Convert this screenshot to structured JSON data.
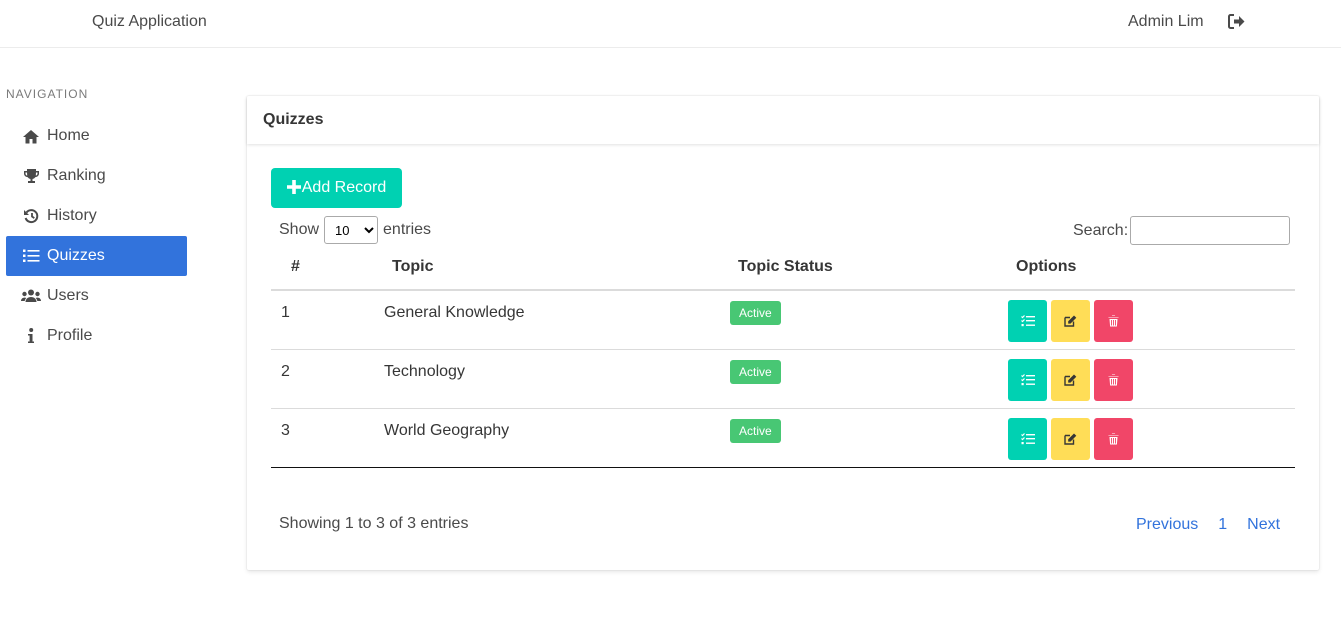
{
  "navbar": {
    "brand": "Quiz Application",
    "user": "Admin Lim",
    "logout_icon": "sign-out-icon"
  },
  "sidebar": {
    "label": "NAVIGATION",
    "items": [
      {
        "label": "Home",
        "icon": "home-icon"
      },
      {
        "label": "Ranking",
        "icon": "trophy-icon"
      },
      {
        "label": "History",
        "icon": "history-icon"
      },
      {
        "label": "Quizzes",
        "icon": "list-icon",
        "active": true
      },
      {
        "label": "Users",
        "icon": "users-icon"
      },
      {
        "label": "Profile",
        "icon": "info-icon"
      }
    ]
  },
  "card": {
    "title": "Quizzes",
    "add_button": "Add Record",
    "length": {
      "show": "Show",
      "value": "10",
      "entries": "entries"
    },
    "search_label": "Search:",
    "search_value": "",
    "columns": [
      "#",
      "Topic",
      "Topic Status",
      "Options"
    ],
    "rows": [
      {
        "num": "1",
        "topic": "General Knowledge",
        "status": "Active"
      },
      {
        "num": "2",
        "topic": "Technology",
        "status": "Active"
      },
      {
        "num": "3",
        "topic": "World Geography",
        "status": "Active"
      }
    ],
    "info": "Showing 1 to 3 of 3 entries",
    "pagination": {
      "previous": "Previous",
      "page": "1",
      "next": "Next"
    }
  },
  "colors": {
    "primary": "#3273dc",
    "turquoise": "#00d1b2",
    "warning": "#ffdd57",
    "danger": "#f14668",
    "success": "#48c774"
  }
}
